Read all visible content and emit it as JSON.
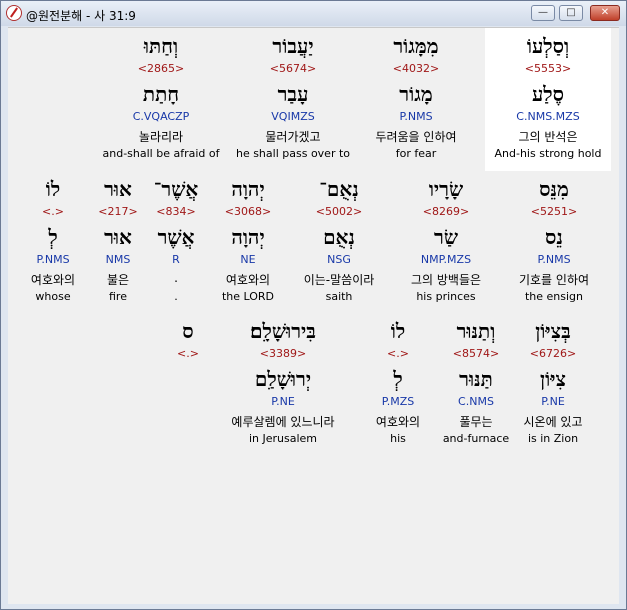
{
  "window": {
    "title": "@원전분해 - 사 31:9",
    "controls": {
      "minimize": "—",
      "maximize": "□",
      "close": "✕"
    }
  },
  "rows": [
    [
      {
        "hebrew": "וְסַלְעוֹ",
        "strong": "<5553>",
        "lemma": "סֶלַע",
        "morph": "C.NMS.MZS",
        "korean": "그의 반석은",
        "english": "And-his strong hold",
        "selected": true
      },
      {
        "hebrew": "מִמָּגוֹר",
        "strong": "<4032>",
        "lemma": "מָגוֹר",
        "morph": "P.NMS",
        "korean": "두려움을 인하여",
        "english": "for fear"
      },
      {
        "hebrew": "יַעֲבוֹר",
        "strong": "<5674>",
        "lemma": "עָבַר",
        "morph": "VQIMZS",
        "korean": "물러가겠고",
        "english": "he shall pass over to"
      },
      {
        "hebrew": "וְחַתּוּ",
        "strong": "<2865>",
        "lemma": "חָתַת",
        "morph": "C.VQACZP",
        "korean": "놀라리라",
        "english": "and-shall be afraid of"
      }
    ],
    [
      {
        "hebrew": "מִנֵּס",
        "strong": "<5251>",
        "lemma": "נֵס",
        "morph": "P.NMS",
        "korean": "기호를 인하여",
        "english": "the ensign"
      },
      {
        "hebrew": "שָׂרָיו",
        "strong": "<8269>",
        "lemma": "שַׂר",
        "morph": "NMP.MZS",
        "korean": "그의 방백들은",
        "english": "his princes"
      },
      {
        "hebrew": "נְאֻם־",
        "strong": "<5002>",
        "lemma": "נְאֻם",
        "morph": "NSG",
        "korean": "이는-말씀이라",
        "english": "saith"
      },
      {
        "hebrew": "יְהוָה",
        "strong": "<3068>",
        "lemma": "יְהוָה",
        "morph": "NE",
        "korean": "여호와의",
        "english": "the LORD"
      },
      {
        "hebrew": "אֲשֶׁר־",
        "strong": "<834>",
        "lemma": "אֲשֶׁר",
        "morph": "R",
        "korean": ".",
        "english": "."
      },
      {
        "hebrew": "אוּר",
        "strong": "<217>",
        "lemma": "אוּר",
        "morph": "NMS",
        "korean": "불은",
        "english": "fire"
      },
      {
        "hebrew": "לוֹ",
        "strong": "<.>",
        "lemma": "לְ",
        "morph": "P.NMS",
        "korean": "여호와의",
        "english": "whose"
      }
    ],
    [
      {
        "hebrew": "בְּצִיּוֹן",
        "strong": "<6726>",
        "lemma": "צִיּוֹן",
        "morph": "P.NE",
        "korean": "시온에 있고",
        "english": "is in Zion"
      },
      {
        "hebrew": "וְתַנּוּר",
        "strong": "<8574>",
        "lemma": "תַּנּוּר",
        "morph": "C.NMS",
        "korean": "풀무는",
        "english": "and-furnace"
      },
      {
        "hebrew": "לוֹ",
        "strong": "<.>",
        "lemma": "לְ",
        "morph": "P.MZS",
        "korean": "여호와의",
        "english": "his"
      },
      {
        "hebrew": "בִּירוּשָׁלִָם׃",
        "strong": "<3389>",
        "lemma": "יְרוּשָׁלִַם",
        "morph": "P.NE",
        "korean": "예루살렘에 있느니라",
        "english": "in Jerusalem"
      },
      {
        "hebrew": "ס",
        "strong": "<.>",
        "lemma": "",
        "morph": "",
        "korean": "",
        "english": ""
      }
    ]
  ]
}
